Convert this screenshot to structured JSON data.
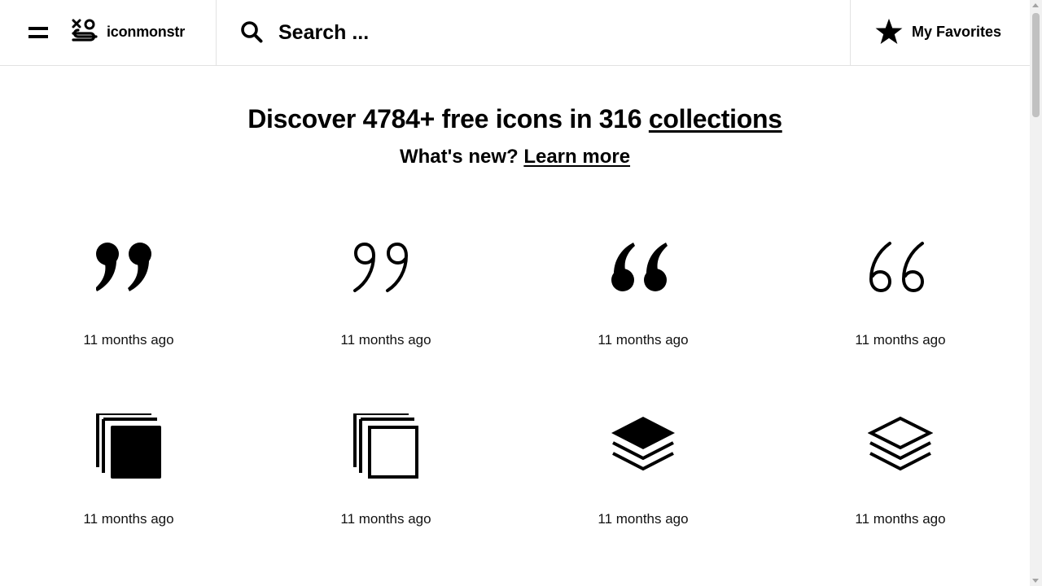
{
  "header": {
    "brand_name": "iconmonstr",
    "search_placeholder": "Search ...",
    "favorites_label": "My Favorites"
  },
  "hero": {
    "title_prefix": "Discover 4784+ free icons in 316 ",
    "title_link": "collections",
    "subtitle_prefix": "What's new? ",
    "subtitle_link": "Learn more"
  },
  "icons": [
    {
      "icon": "quote-right-filled-icon",
      "caption": "11 months ago"
    },
    {
      "icon": "quote-right-outline-icon",
      "caption": "11 months ago"
    },
    {
      "icon": "quote-left-filled-icon",
      "caption": "11 months ago"
    },
    {
      "icon": "quote-left-outline-icon",
      "caption": "11 months ago"
    },
    {
      "icon": "copy-filled-icon",
      "caption": "11 months ago"
    },
    {
      "icon": "copy-outline-icon",
      "caption": "11 months ago"
    },
    {
      "icon": "layers-filled-icon",
      "caption": "11 months ago"
    },
    {
      "icon": "layers-outline-icon",
      "caption": "11 months ago"
    }
  ]
}
